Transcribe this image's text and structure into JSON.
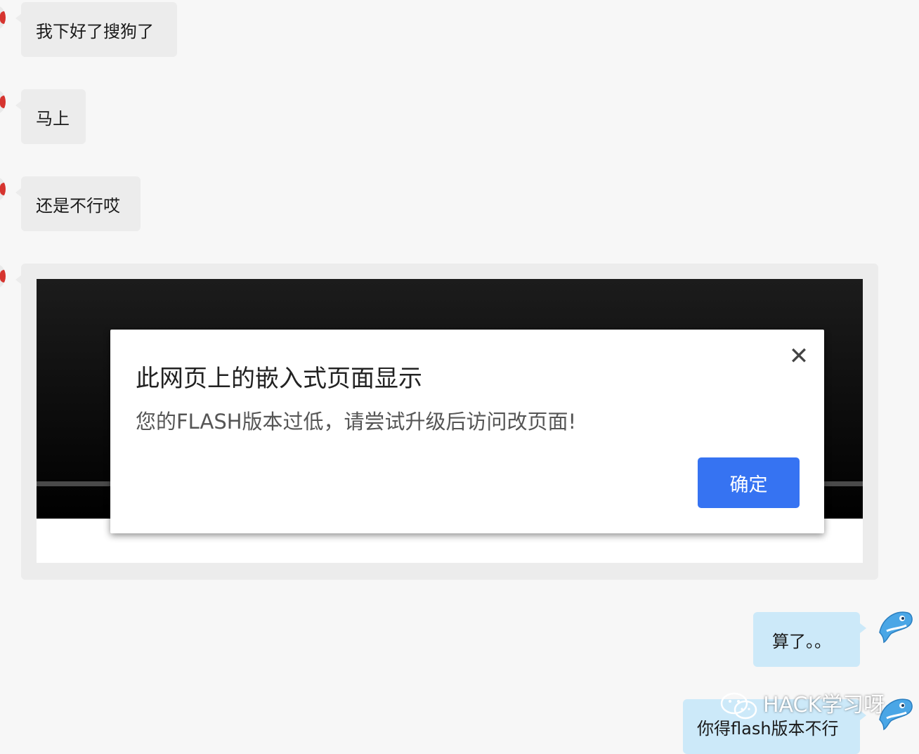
{
  "messages": {
    "m1": "我下好了搜狗了",
    "m2": "马上",
    "m3": "还是不行哎",
    "m4": "算了。。",
    "m5": "你得flash版本不行"
  },
  "dialog": {
    "title": "此网页上的嵌入式页面显示",
    "message": "您的FLASH版本过低，请尝试升级后访问改页面!",
    "ok_label": "确定",
    "close_glyph": "✕"
  },
  "watermark": {
    "text": "HACK学习呀"
  },
  "colors": {
    "incoming_bubble": "#ececec",
    "outgoing_bubble": "#cce9f9",
    "primary_button": "#3673f2",
    "page_background": "#f7f7f7"
  },
  "icons": {
    "avatar_left": "red-avatar-icon",
    "avatar_right": "blue-dolphin-avatar-icon",
    "watermark_logo": "wechat-icon"
  }
}
